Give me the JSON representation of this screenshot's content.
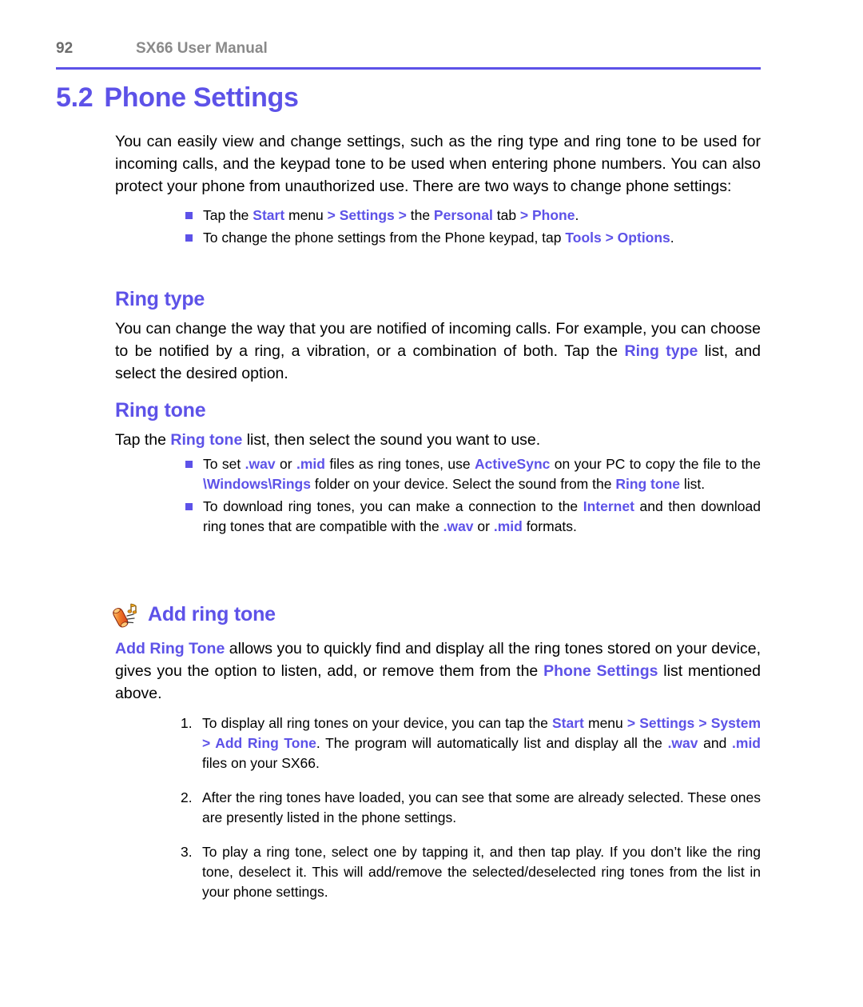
{
  "header": {
    "folio": "92",
    "title": "SX66 User Manual"
  },
  "chapter": {
    "number": "5.2",
    "title": "Phone Settings"
  },
  "intro": {
    "text": "You can easily view and change settings, such as the ring type and ring tone to be used for incoming calls, and the keypad tone to be used when entering phone numbers. You can also protect your phone from unauthorized use. There are two ways to change phone settings:"
  },
  "intro_bullets": [
    {
      "parts": [
        {
          "text": "Tap the ",
          "style": "plain"
        },
        {
          "text": "Start",
          "style": "accent"
        },
        {
          "text": " menu ",
          "style": "plain"
        },
        {
          "text": "> Settings >",
          "style": "accent"
        },
        {
          "text": " the ",
          "style": "plain"
        },
        {
          "text": "Personal",
          "style": "accent"
        },
        {
          "text": " tab ",
          "style": "plain"
        },
        {
          "text": "> Phone",
          "style": "accent"
        },
        {
          "text": ".",
          "style": "plain"
        }
      ]
    },
    {
      "parts": [
        {
          "text": "To change the phone settings from the Phone keypad, tap ",
          "style": "plain"
        },
        {
          "text": "Tools > Options",
          "style": "accent"
        },
        {
          "text": ".",
          "style": "plain"
        }
      ]
    }
  ],
  "ring_type": {
    "heading": "Ring type",
    "body_parts": [
      {
        "text": "You can change the way that you are notified of incoming calls. For example, you can choose to be notified by a ring, a vibration, or a combination of both. Tap the ",
        "style": "plain"
      },
      {
        "text": "Ring type",
        "style": "accent"
      },
      {
        "text": " list, and select the desired option.",
        "style": "plain"
      }
    ]
  },
  "ring_tone": {
    "heading": "Ring tone",
    "lead_parts": [
      {
        "text": "Tap the ",
        "style": "plain"
      },
      {
        "text": "Ring tone",
        "style": "accent"
      },
      {
        "text": " list, then select the sound you want to use.",
        "style": "plain"
      }
    ],
    "bullets": [
      {
        "parts": [
          {
            "text": "To set ",
            "style": "plain"
          },
          {
            "text": ".wav",
            "style": "accent"
          },
          {
            "text": " or ",
            "style": "plain"
          },
          {
            "text": ".mid",
            "style": "accent"
          },
          {
            "text": " files as ring tones, use ",
            "style": "plain"
          },
          {
            "text": "ActiveSync",
            "style": "accent"
          },
          {
            "text": " on your PC to copy the file to the ",
            "style": "plain"
          },
          {
            "text": "\\Windows\\Rings",
            "style": "accent"
          },
          {
            "text": " folder on your device. Select the sound from the ",
            "style": "plain"
          },
          {
            "text": "Ring tone",
            "style": "accent"
          },
          {
            "text": " list.",
            "style": "plain"
          }
        ]
      },
      {
        "parts": [
          {
            "text": "To download ring tones, you can make a connection to the ",
            "style": "plain"
          },
          {
            "text": "Internet",
            "style": "accent"
          },
          {
            "text": " and then download ring tones that are compatible with the ",
            "style": "plain"
          },
          {
            "text": ".wav",
            "style": "accent"
          },
          {
            "text": " or ",
            "style": "plain"
          },
          {
            "text": ".mid",
            "style": "accent"
          },
          {
            "text": " formats.",
            "style": "plain"
          }
        ]
      }
    ]
  },
  "add_ring_tone": {
    "icon": "ringtone-phone-note-icon",
    "heading": "Add ring tone",
    "body_parts": [
      {
        "text": "Add Ring Tone",
        "style": "accent"
      },
      {
        "text": " allows you to quickly find and display all the ring tones stored on your device, gives you the option to listen, add, or remove them from the ",
        "style": "plain"
      },
      {
        "text": "Phone Settings",
        "style": "accent"
      },
      {
        "text": " list mentioned above.",
        "style": "plain"
      }
    ],
    "steps": [
      {
        "number": "1.",
        "parts": [
          {
            "text": "To display all ring tones on your device, you can tap the ",
            "style": "plain"
          },
          {
            "text": "Start",
            "style": "accent"
          },
          {
            "text": " menu ",
            "style": "plain"
          },
          {
            "text": "> Settings > System > Add Ring Tone",
            "style": "accent"
          },
          {
            "text": ". The program will automatically list and display all the ",
            "style": "plain"
          },
          {
            "text": ".wav",
            "style": "accent"
          },
          {
            "text": " and ",
            "style": "plain"
          },
          {
            "text": ".mid",
            "style": "accent"
          },
          {
            "text": " files on your SX66.",
            "style": "plain"
          }
        ]
      },
      {
        "number": "2.",
        "parts": [
          {
            "text": "After the ring tones have loaded, you can see that some are already selected. These ones are presently listed in the phone settings.",
            "style": "plain"
          }
        ]
      },
      {
        "number": "3.",
        "parts": [
          {
            "text": "To play a ring tone, select one by tapping it, and then tap play. If you don’t like the ring tone, deselect it. This will add/remove the selected/deselected ring tones from the list in your phone settings.",
            "style": "plain"
          }
        ]
      }
    ]
  },
  "colors": {
    "accent": "#5d52e8",
    "header_gray": "#8a8a8a",
    "folio_gray": "#6c6c6c",
    "body": "#000000",
    "page_bg": "#ffffff"
  }
}
